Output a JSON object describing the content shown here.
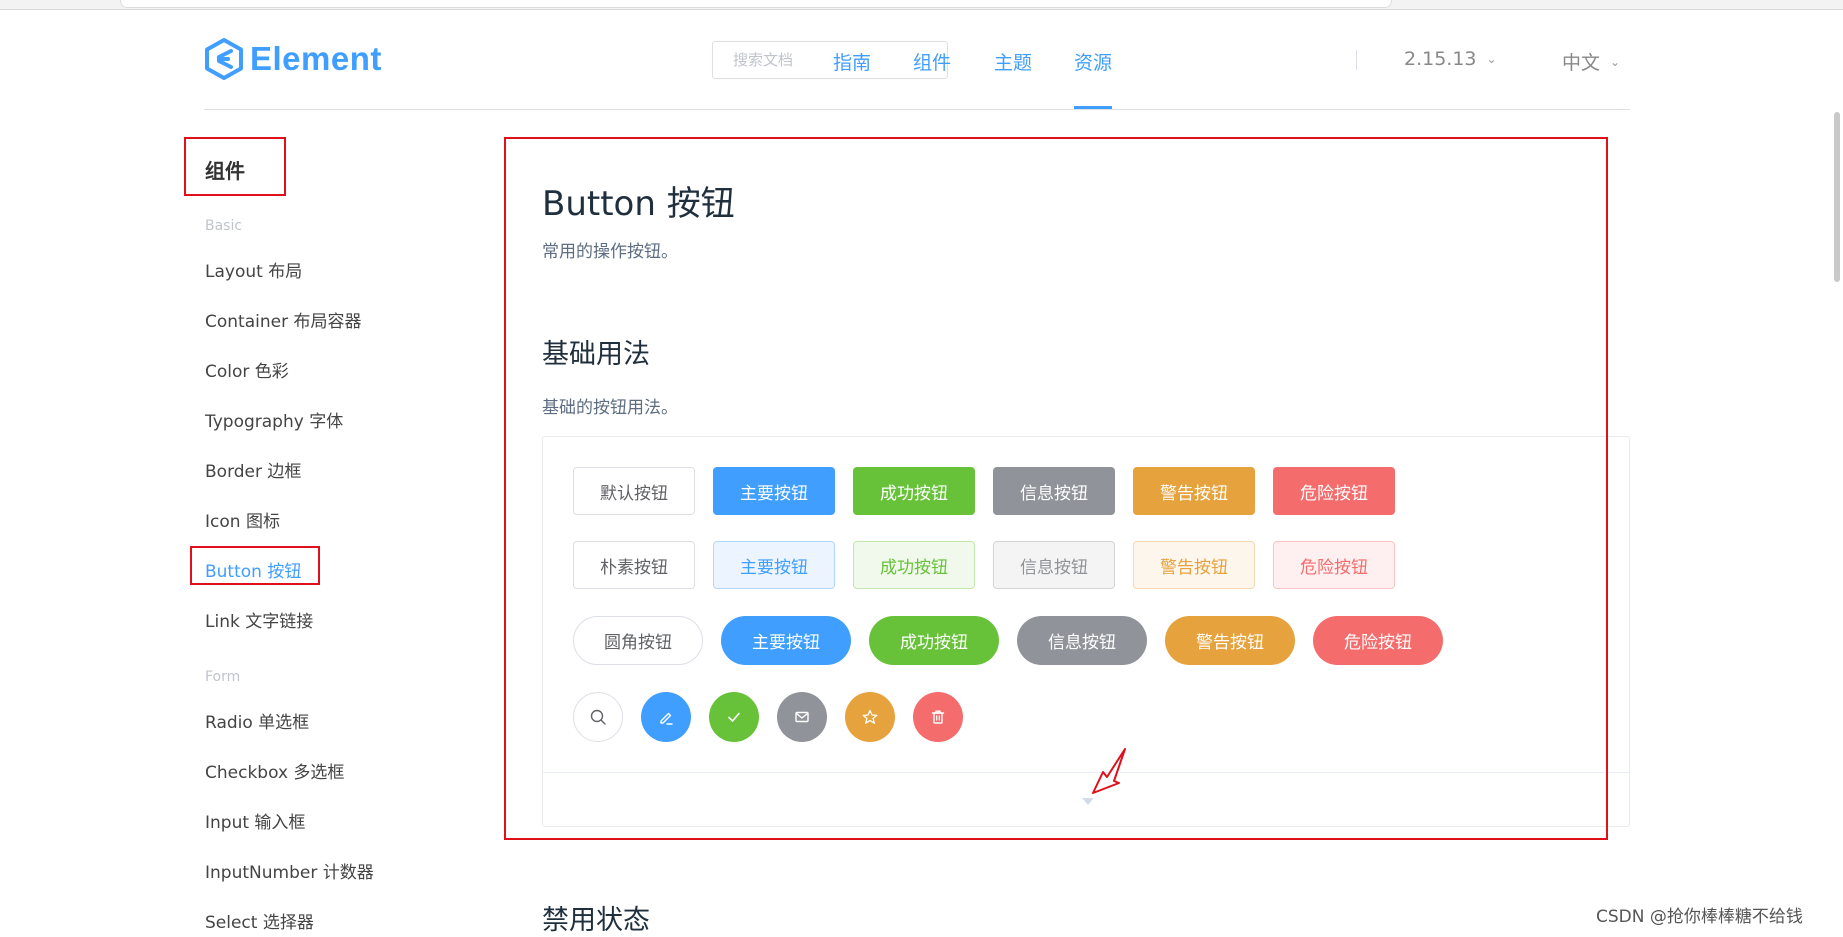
{
  "header": {
    "logo_text": "Element",
    "search_placeholder": "搜索文档",
    "nav": [
      "指南",
      "组件",
      "主题",
      "资源"
    ],
    "active_nav": "组件",
    "version": "2.15.13",
    "language": "中文"
  },
  "sidebar": {
    "title": "组件",
    "groups": [
      {
        "label": "Basic",
        "items": [
          "Layout 布局",
          "Container 布局容器",
          "Color 色彩",
          "Typography 字体",
          "Border 边框",
          "Icon 图标",
          "Button 按钮",
          "Link 文字链接"
        ]
      },
      {
        "label": "Form",
        "items": [
          "Radio 单选框",
          "Checkbox 多选框",
          "Input 输入框",
          "InputNumber 计数器",
          "Select 选择器"
        ]
      }
    ],
    "active_item": "Button 按钮"
  },
  "main": {
    "title": "Button 按钮",
    "description": "常用的操作按钮。",
    "section_title": "基础用法",
    "section_description": "基础的按钮用法。",
    "row1": [
      "默认按钮",
      "主要按钮",
      "成功按钮",
      "信息按钮",
      "警告按钮",
      "危险按钮"
    ],
    "row2": [
      "朴素按钮",
      "主要按钮",
      "成功按钮",
      "信息按钮",
      "警告按钮",
      "危险按钮"
    ],
    "row3": [
      "圆角按钮",
      "主要按钮",
      "成功按钮",
      "信息按钮",
      "警告按钮",
      "危险按钮"
    ],
    "icon_buttons": [
      "search-icon",
      "edit-icon",
      "check-icon",
      "message-icon",
      "star-icon",
      "delete-icon"
    ],
    "next_section_title": "禁用状态"
  },
  "colors": {
    "primary": "#409eff",
    "success": "#67c23a",
    "info": "#909399",
    "warning": "#e6a23c",
    "danger": "#f56c6c",
    "annotation": "#e0101a"
  },
  "watermark": "CSDN @抢你棒棒糖不给钱"
}
